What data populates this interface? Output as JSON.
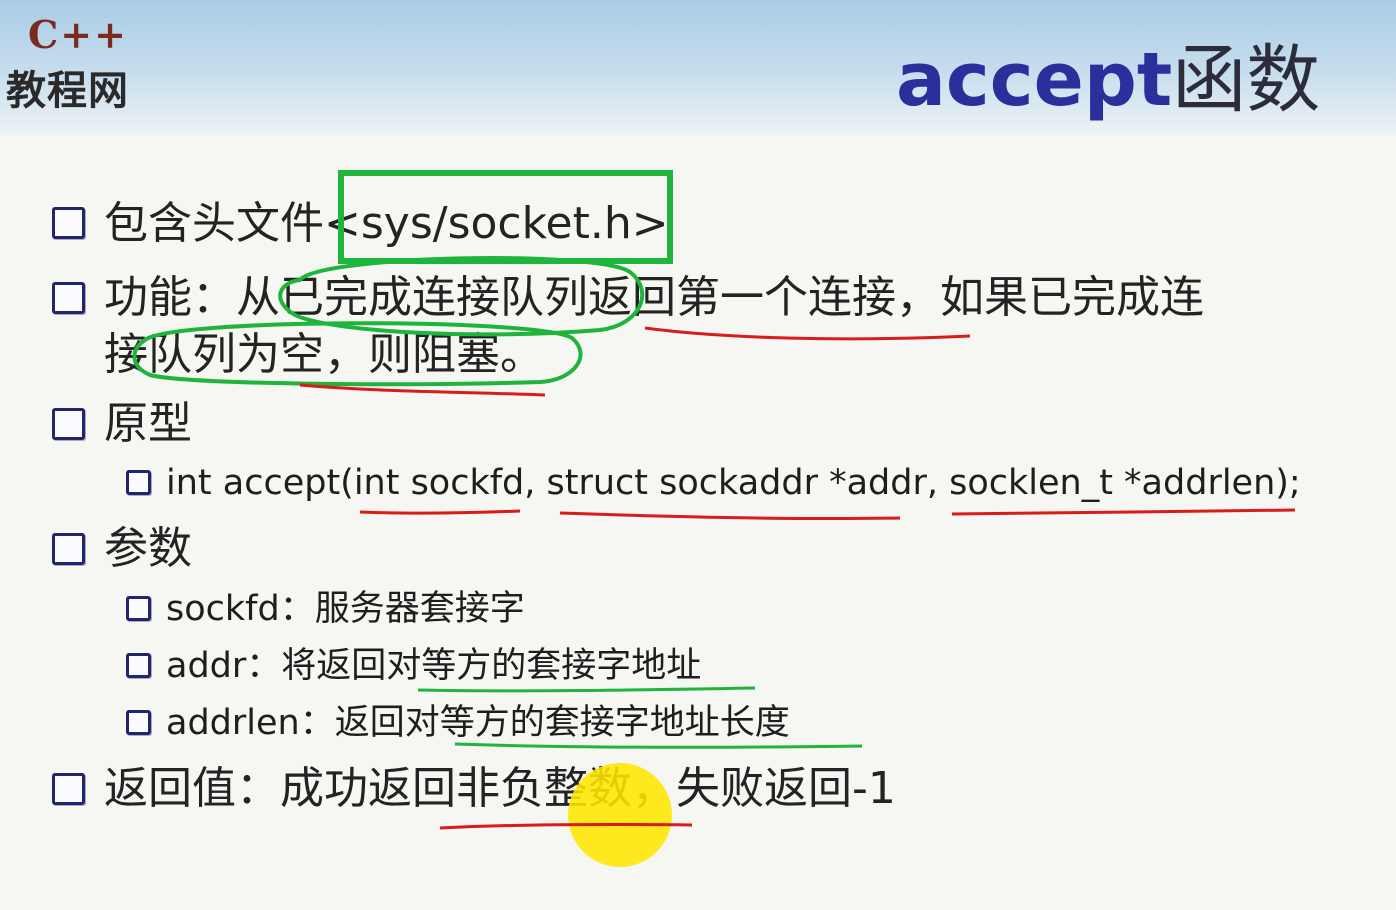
{
  "logo": {
    "cpp": "C++",
    "name": "教程网"
  },
  "title": {
    "en": "accept",
    "cn": "函数"
  },
  "bullets": {
    "header_file": "包含头文件<sys/socket.h>",
    "function_line1": "功能：从已完成连接队列返回第一个连接，如果已完成连",
    "function_line2": "接队列为空，则阻塞。",
    "prototype": "原型",
    "prototype_code": "int accept(int sockfd, struct sockaddr *addr, socklen_t *addrlen);",
    "params": "参数",
    "param_sockfd": "sockfd：服务器套接字",
    "param_addr": "addr：将返回对等方的套接字地址",
    "param_addrlen": "addrlen：返回对等方的套接字地址长度",
    "return_value": "返回值：成功返回非负整数，失败返回-1"
  },
  "colors": {
    "title": "#2a2f9c",
    "bullet_box": "#22256e",
    "annotation_green": "#1fb53c",
    "annotation_red": "#d81b1b",
    "cursor_highlight": "#ffe600"
  }
}
